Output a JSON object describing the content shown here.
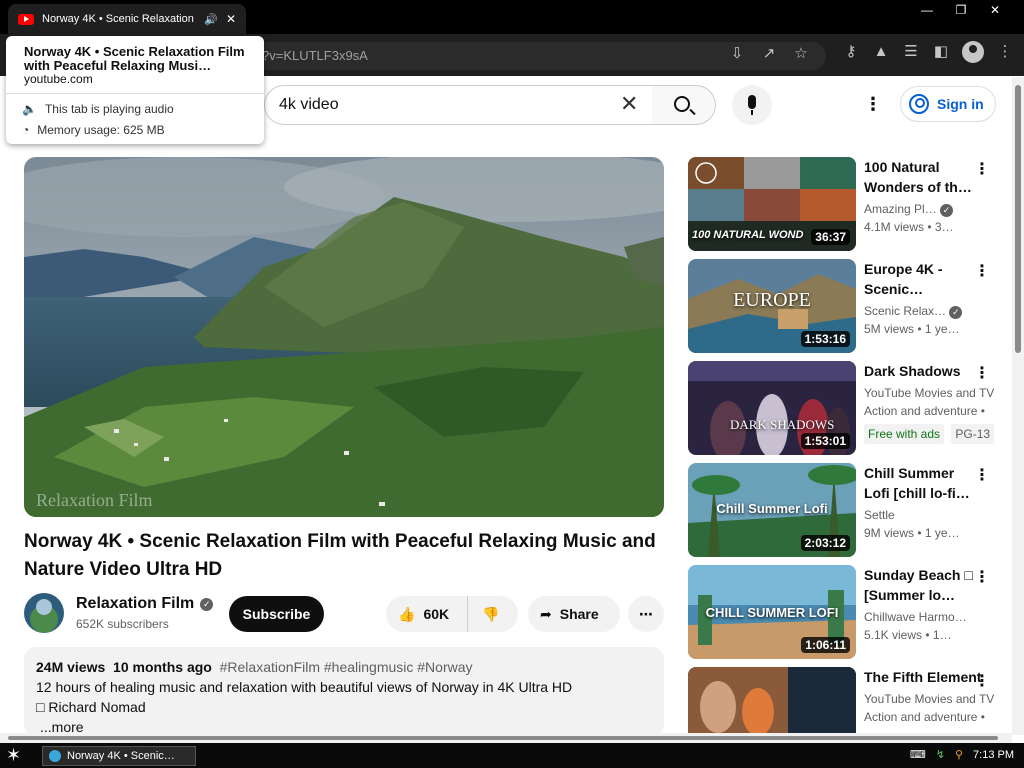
{
  "browser": {
    "tab_title": "Norway 4K • Scenic Relaxation",
    "url": "?v=KLUTLF3x9sA",
    "hovercard": {
      "title": "Norway 4K • Scenic Relaxation Film with Peaceful Relaxing Musi…",
      "domain": "youtube.com",
      "audio": "This tab is playing audio",
      "memory": "Memory usage: 625 MB"
    }
  },
  "header": {
    "search_value": "4k video",
    "signin": "Sign in"
  },
  "video": {
    "watermark": "Relaxation Film",
    "title": "Norway 4K • Scenic Relaxation Film with Peaceful Relaxing Music and Nature Video Ultra HD",
    "channel": "Relaxation Film",
    "subscribers": "652K subscribers",
    "subscribe": "Subscribe",
    "likes": "60K",
    "share": "Share"
  },
  "description": {
    "views": "24M views",
    "age": "10 months ago",
    "tags": "#RelaxationFilm #healingmusic #Norway",
    "line1": "12 hours of healing music and relaxation with beautiful views of Norway in 4K Ultra HD",
    "line2": "□ Richard Nomad",
    "more": "...more"
  },
  "recommendations": [
    {
      "title": "100 Natural Wonders of th…",
      "line1": "Amazing Pl…",
      "line2": "4.1M views  • 3…",
      "duration": "36:37",
      "thumb_text": "100 NATURAL WOND"
    },
    {
      "title": "Europe 4K - Scenic…",
      "line1": "Scenic Relax…",
      "line2": "5M views  • 1 ye…",
      "duration": "1:53:16",
      "thumb_text": "EUROPE"
    },
    {
      "title": "Dark Shadows",
      "line1": "YouTube Movies and TV",
      "line2": "Action and adventure •",
      "badge_free": "Free with ads",
      "badge_rating": "PG-13",
      "duration": "1:53:01",
      "thumb_text": "DARK SHADOWS"
    },
    {
      "title": "Chill Summer Lofi [chill lo-fi…",
      "line1": "Settle",
      "line2": "9M views  • 1 ye…",
      "duration": "2:03:12",
      "thumb_text": "Chill Summer Lofi"
    },
    {
      "title": "Sunday Beach □ [Summer lo…",
      "line1": "Chillwave Harmo…",
      "line2": "5.1K views  • 1…",
      "duration": "1:06:11",
      "thumb_text": "CHILL SUMMER LOFI"
    },
    {
      "title": "The Fifth Element",
      "line1": "YouTube Movies and TV",
      "line2": "Action and adventure •",
      "duration": "",
      "thumb_text": ""
    }
  ],
  "taskbar": {
    "item": "Norway 4K • Scenic…",
    "time": "7:13 PM"
  },
  "colors": {
    "accent": "#065fd4",
    "youtube_red": "#ff0000",
    "free_green": "#107516"
  }
}
